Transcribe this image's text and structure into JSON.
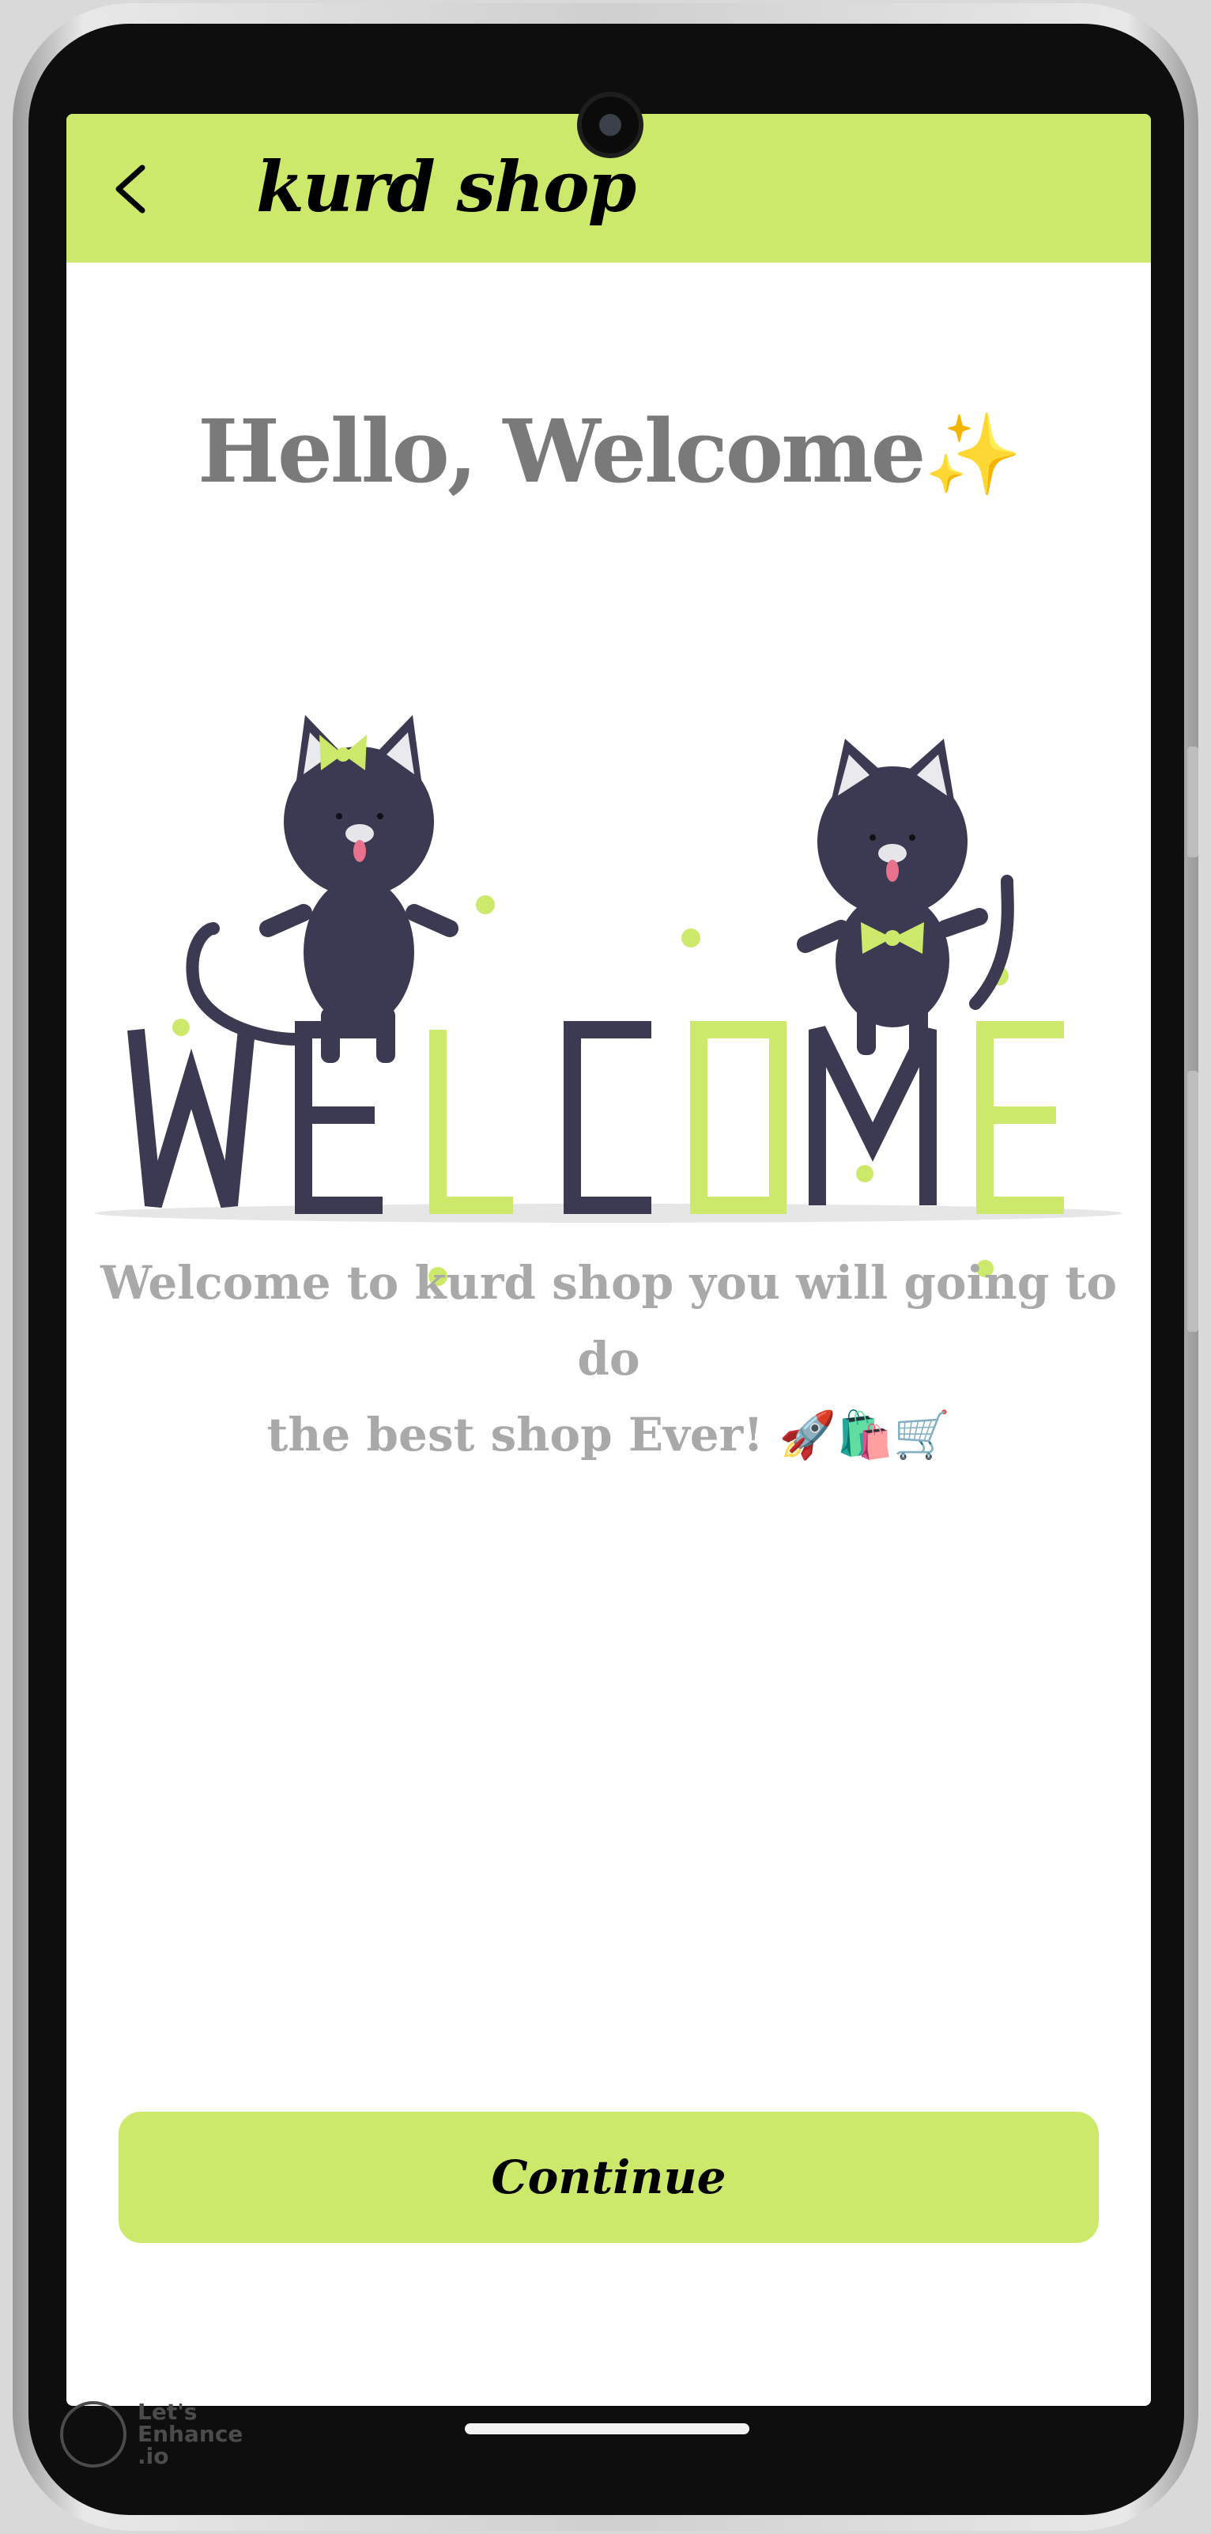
{
  "header": {
    "title": "kurd shop",
    "accent": "#cde96c"
  },
  "main": {
    "headline": "Hello, Welcome",
    "headline_emoji": "✨",
    "description_line1": "Welcome to kurd shop you will going to do",
    "description_line2": "the best shop Ever! 🚀🛍️🛒",
    "illustration_text": "WELCOME",
    "continue_label": "Continue"
  },
  "watermark": {
    "line1": "Let's",
    "line2": "Enhance",
    "line3": ".io"
  },
  "icons": [
    "back-arrow-icon",
    "sparkles-icon",
    "rocket-icon",
    "shopping-bags-icon",
    "shopping-cart-icon"
  ],
  "colors": {
    "lime": "#cde96c",
    "navy": "#3b3a52",
    "headline_gray": "#7a7a7a",
    "text_gray": "#a9a9a9"
  }
}
